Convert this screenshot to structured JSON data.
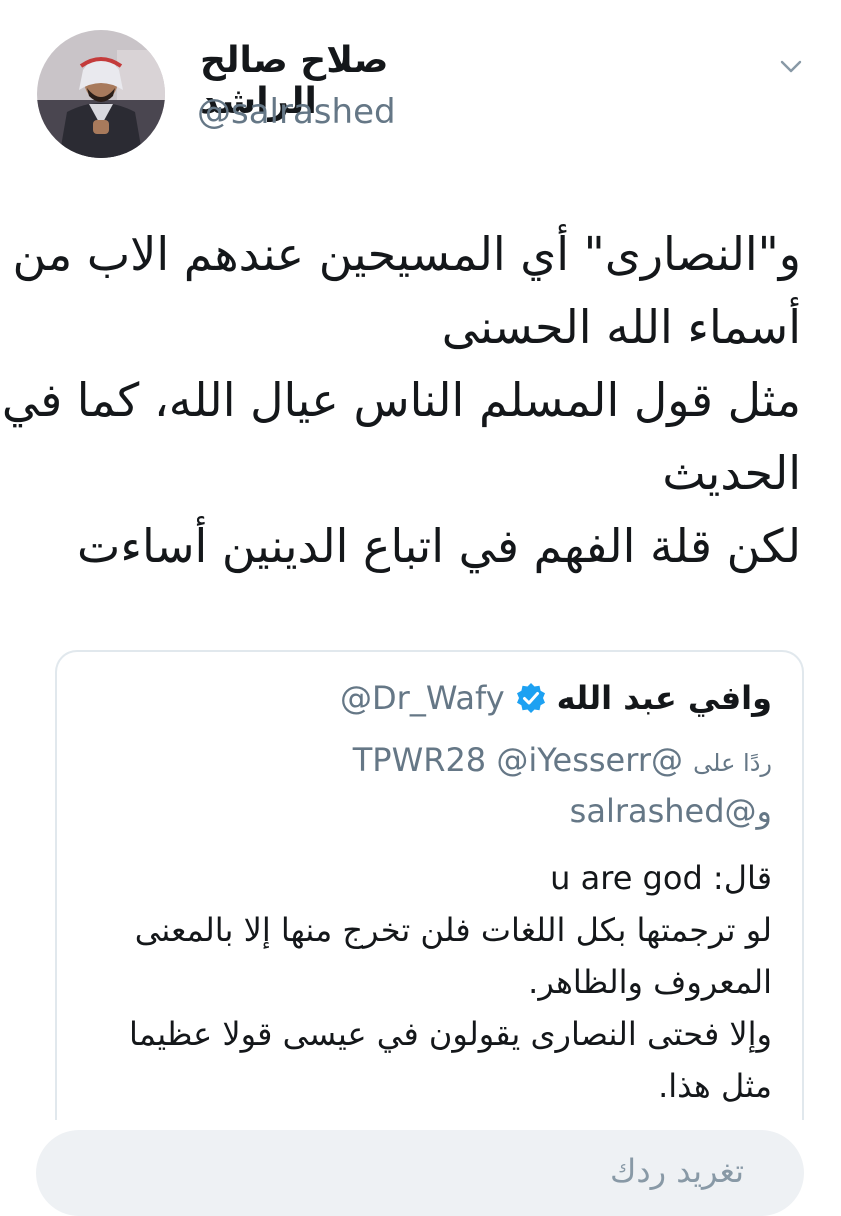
{
  "header": {
    "display_name": "صلاح صالح الراشد",
    "handle": "@salrashed",
    "menu_icon": "chevron-down-icon"
  },
  "tweet": {
    "lines": [
      "و\"النصارى\" أي المسيحين عندهم الاب من",
      "أسماء الله الحسنى",
      "مثل قول المسلم الناس عيال الله، كما في",
      "الحديث",
      "لكن قلة الفهم في اتباع الدينين أساءت"
    ]
  },
  "quoted_tweet": {
    "display_name": "وافي عبد الله",
    "verified_icon": "verified-badge-icon",
    "handle": "@Dr_Wafy",
    "reply_prefix": "ردًا على",
    "reply_mentions": "@TPWR28 @iYesserr",
    "reply_mentions_2": "و@salrashed",
    "said_prefix": "قال:",
    "said_quote": "u are god",
    "body_lines": [
      "لو ترجمتها بكل اللغات فلن تخرج منها إلا بالمعنى",
      "المعروف والظاهر.",
      "وإلا فحتى النصارى يقولون في عيسى قولا عظيما",
      "مثل هذا."
    ]
  },
  "reply_bar": {
    "placeholder": "تغريد ردك"
  },
  "colors": {
    "text": "#14171a",
    "muted": "#657786",
    "verified": "#1da1f2",
    "border": "#e1e8ed",
    "input_bg": "#eef1f4"
  }
}
